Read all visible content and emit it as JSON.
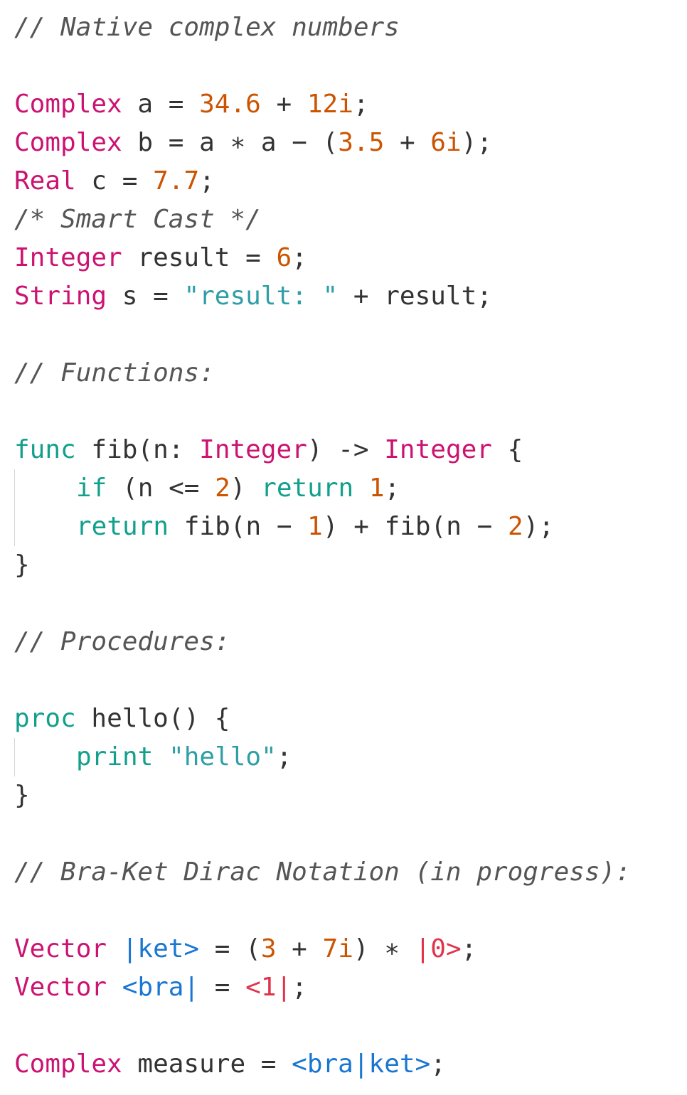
{
  "editor": {
    "comments": {
      "native": "// Native complex numbers",
      "smart_cast": "/* Smart Cast */",
      "functions": "// Functions:",
      "procedures": "// Procedures:",
      "braket": "// Bra-Ket Dirac Notation (in progress):"
    },
    "types": {
      "complex": "Complex",
      "real": "Real",
      "integer": "Integer",
      "string": "String",
      "vector": "Vector"
    },
    "keywords": {
      "func": "func",
      "if": "if",
      "return": "return",
      "proc": "proc",
      "print": "print"
    },
    "identifiers": {
      "a": "a",
      "b": "b",
      "c": "c",
      "n": "n",
      "s": "s",
      "result": "result",
      "fib": "fib",
      "hello": "hello",
      "measure": "measure"
    },
    "numbers": {
      "n34_6": "34.6",
      "n12i": "12i",
      "n3_5": "3.5",
      "n6i": "6i",
      "n7_7": "7.7",
      "n6": "6",
      "n2": "2",
      "n1": "1",
      "n3": "3",
      "n7i": "7i"
    },
    "strings": {
      "result_prefix": "\"result: \"",
      "hello": "\"hello\""
    },
    "quantum": {
      "ket": "|ket>",
      "bra": "<bra|",
      "ket0": "|0>",
      "bra1": "<1|",
      "braket": "<bra|ket>"
    }
  },
  "colors": {
    "comment": "#555555",
    "type": "#cc1372",
    "keyword": "#12a08c",
    "number": "#cc5400",
    "string": "#2f9ea6",
    "vector_name": "#1976d2",
    "basis_state": "#e0334b",
    "default_text": "#333333",
    "background": "#ffffff"
  }
}
